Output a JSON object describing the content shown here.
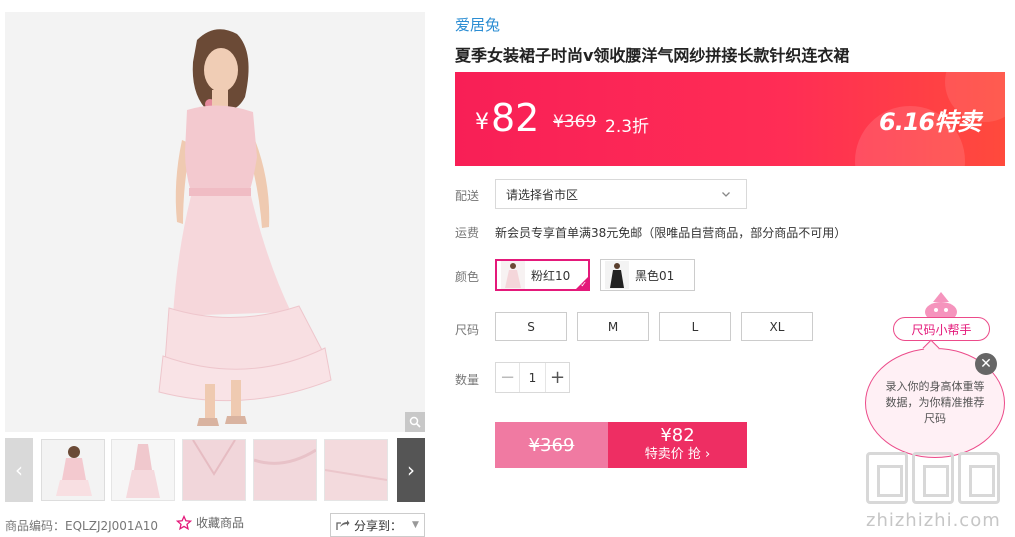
{
  "product": {
    "brand": "爱居兔",
    "title": "夏季女装裙子时尚v领收腰洋气网纱拼接长款针织连衣裙",
    "code_label": "商品编码：",
    "code_value": "EQLZJ2J001A10",
    "favorite_label": "收藏商品",
    "share_label": "分享到："
  },
  "price": {
    "currency": "¥",
    "current": "82",
    "original": "¥369",
    "discount": "2.3折",
    "promo_tag": "6.16特卖"
  },
  "options": {
    "delivery_label": "配送",
    "delivery_placeholder": "请选择省市区",
    "shipping_label": "运费",
    "shipping_text": "新会员专享首单满38元免邮（限唯品自营商品，部分商品不可用）",
    "color_label": "颜色",
    "colors": [
      {
        "name": "粉红10",
        "selected": true,
        "swatch_color": "#f4d6da"
      },
      {
        "name": "黑色01",
        "selected": false,
        "swatch_color": "#222222"
      }
    ],
    "size_label": "尺码",
    "sizes": [
      "S",
      "M",
      "L",
      "XL"
    ],
    "quantity_label": "数量",
    "quantity_value": "1",
    "qty_minus": "−",
    "qty_plus": "+"
  },
  "buy": {
    "original_price": "¥369",
    "sale_price": "¥82",
    "sale_text": "特卖价 抢 ›"
  },
  "size_helper": {
    "tag": "尺码小帮手",
    "bubble_text": "录入你的身高体重等数据，为你精准推荐尺码",
    "close": "✕"
  },
  "gallery": {
    "prev": "‹",
    "next": "›"
  },
  "watermark": {
    "text": "zhizhizhi.com"
  },
  "colors": {
    "accent_pink": "#e4197a",
    "banner_red": "#ff2d55",
    "brand_blue": "#2b8dd3"
  }
}
